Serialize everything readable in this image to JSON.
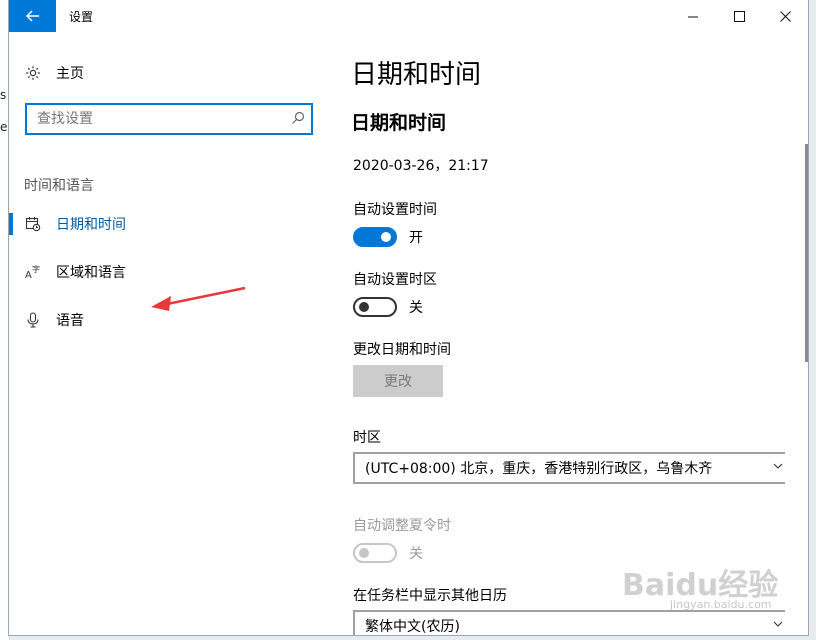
{
  "background": {
    "fragments": [
      "s",
      "e"
    ]
  },
  "window": {
    "title": "设置",
    "back_icon": "back-arrow-icon",
    "minimize_glyph": "—",
    "maximize_glyph": "☐",
    "close_glyph": "✕"
  },
  "sidebar": {
    "home_label": "主页",
    "search_placeholder": "查找设置",
    "section_heading": "时间和语言",
    "items": [
      {
        "label": "日期和时间",
        "icon": "calendar-clock-icon",
        "active": true
      },
      {
        "label": "区域和语言",
        "icon": "language-icon",
        "active": false
      },
      {
        "label": "语音",
        "icon": "microphone-icon",
        "active": false
      }
    ]
  },
  "content": {
    "page_title": "日期和时间",
    "sub_title": "日期和时间",
    "current_datetime": "2020-03-26，21:17",
    "auto_time": {
      "label": "自动设置时间",
      "state_text": "开",
      "on": true
    },
    "auto_timezone": {
      "label": "自动设置时区",
      "state_text": "关",
      "on": false
    },
    "change_datetime": {
      "label": "更改日期和时间",
      "button": "更改"
    },
    "timezone": {
      "label": "时区",
      "value": "(UTC+08:00) 北京，重庆，香港特别行政区，乌鲁木齐"
    },
    "dst": {
      "label": "自动调整夏令时",
      "state_text": "关",
      "enabled": false
    },
    "extra_calendar": {
      "label": "在任务栏中显示其他日历",
      "value": "繁体中文(农历)"
    }
  },
  "colors": {
    "accent": "#0078d7",
    "annotation_arrow": "#e8383b"
  },
  "watermark": {
    "text": "Baidu经验",
    "url": "jingyan.baidu.com"
  }
}
